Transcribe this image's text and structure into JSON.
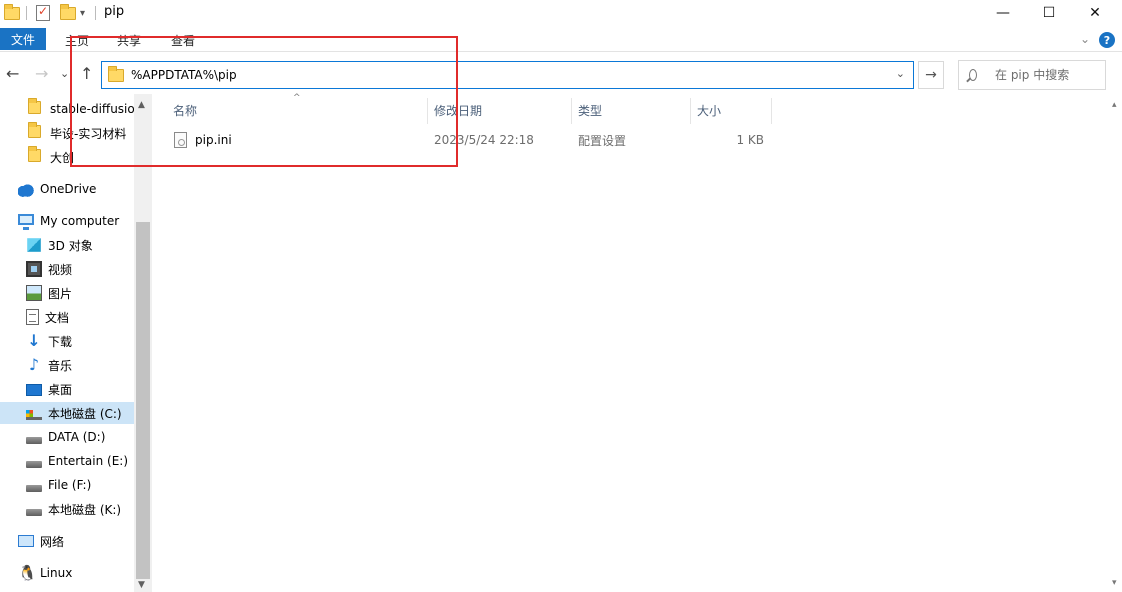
{
  "window": {
    "title": "pip",
    "minimize_icon": "—",
    "maximize_icon": "☐",
    "close_icon": "✕",
    "qa_dropdown": "▾"
  },
  "ribbon": {
    "tabs": [
      "文件",
      "主页",
      "共享",
      "查看"
    ],
    "collapse_icon": "⌄",
    "help_icon": "?"
  },
  "navigation": {
    "back_icon": "←",
    "forward_icon": "→",
    "recent_icon": "⌄",
    "up_icon": "↑",
    "address_path": "%APPDTATA%\\pip",
    "address_dropdown": "⌄",
    "go_icon": "→",
    "search_placeholder": "在 pip 中搜索"
  },
  "sidebar": {
    "items": [
      {
        "label": "stable-diffusion",
        "icon": "folder-icon"
      },
      {
        "label": "毕设-实习材料",
        "icon": "folder-icon"
      },
      {
        "label": "大创",
        "icon": "folder-icon"
      },
      {
        "label": "OneDrive",
        "icon": "onedrive-icon"
      },
      {
        "label": "My computer",
        "icon": "computer-icon"
      },
      {
        "label": "3D 对象",
        "icon": "3d-objects-icon"
      },
      {
        "label": "视频",
        "icon": "video-icon"
      },
      {
        "label": "图片",
        "icon": "pictures-icon"
      },
      {
        "label": "文档",
        "icon": "documents-icon"
      },
      {
        "label": "下载",
        "icon": "downloads-icon"
      },
      {
        "label": "音乐",
        "icon": "music-icon"
      },
      {
        "label": "桌面",
        "icon": "desktop-icon"
      },
      {
        "label": "本地磁盘 (C:)",
        "icon": "drive-c-icon",
        "selected": true
      },
      {
        "label": "DATA (D:)",
        "icon": "drive-icon"
      },
      {
        "label": "Entertain (E:)",
        "icon": "drive-icon"
      },
      {
        "label": "File (F:)",
        "icon": "drive-icon"
      },
      {
        "label": "本地磁盘 (K:)",
        "icon": "drive-icon"
      },
      {
        "label": "网络",
        "icon": "network-icon"
      },
      {
        "label": "Linux",
        "icon": "linux-icon"
      }
    ]
  },
  "file_list": {
    "columns": [
      "名称",
      "修改日期",
      "类型",
      "大小"
    ],
    "sort_indicator": "^",
    "rows": [
      {
        "name": "pip.ini",
        "modified": "2023/5/24 22:18",
        "type": "配置设置",
        "size": "1 KB",
        "icon": "ini-file-icon"
      }
    ]
  },
  "colors": {
    "accent": "#1a73c4",
    "selection": "#cce4f7",
    "highlight_box": "#e02b2b"
  }
}
